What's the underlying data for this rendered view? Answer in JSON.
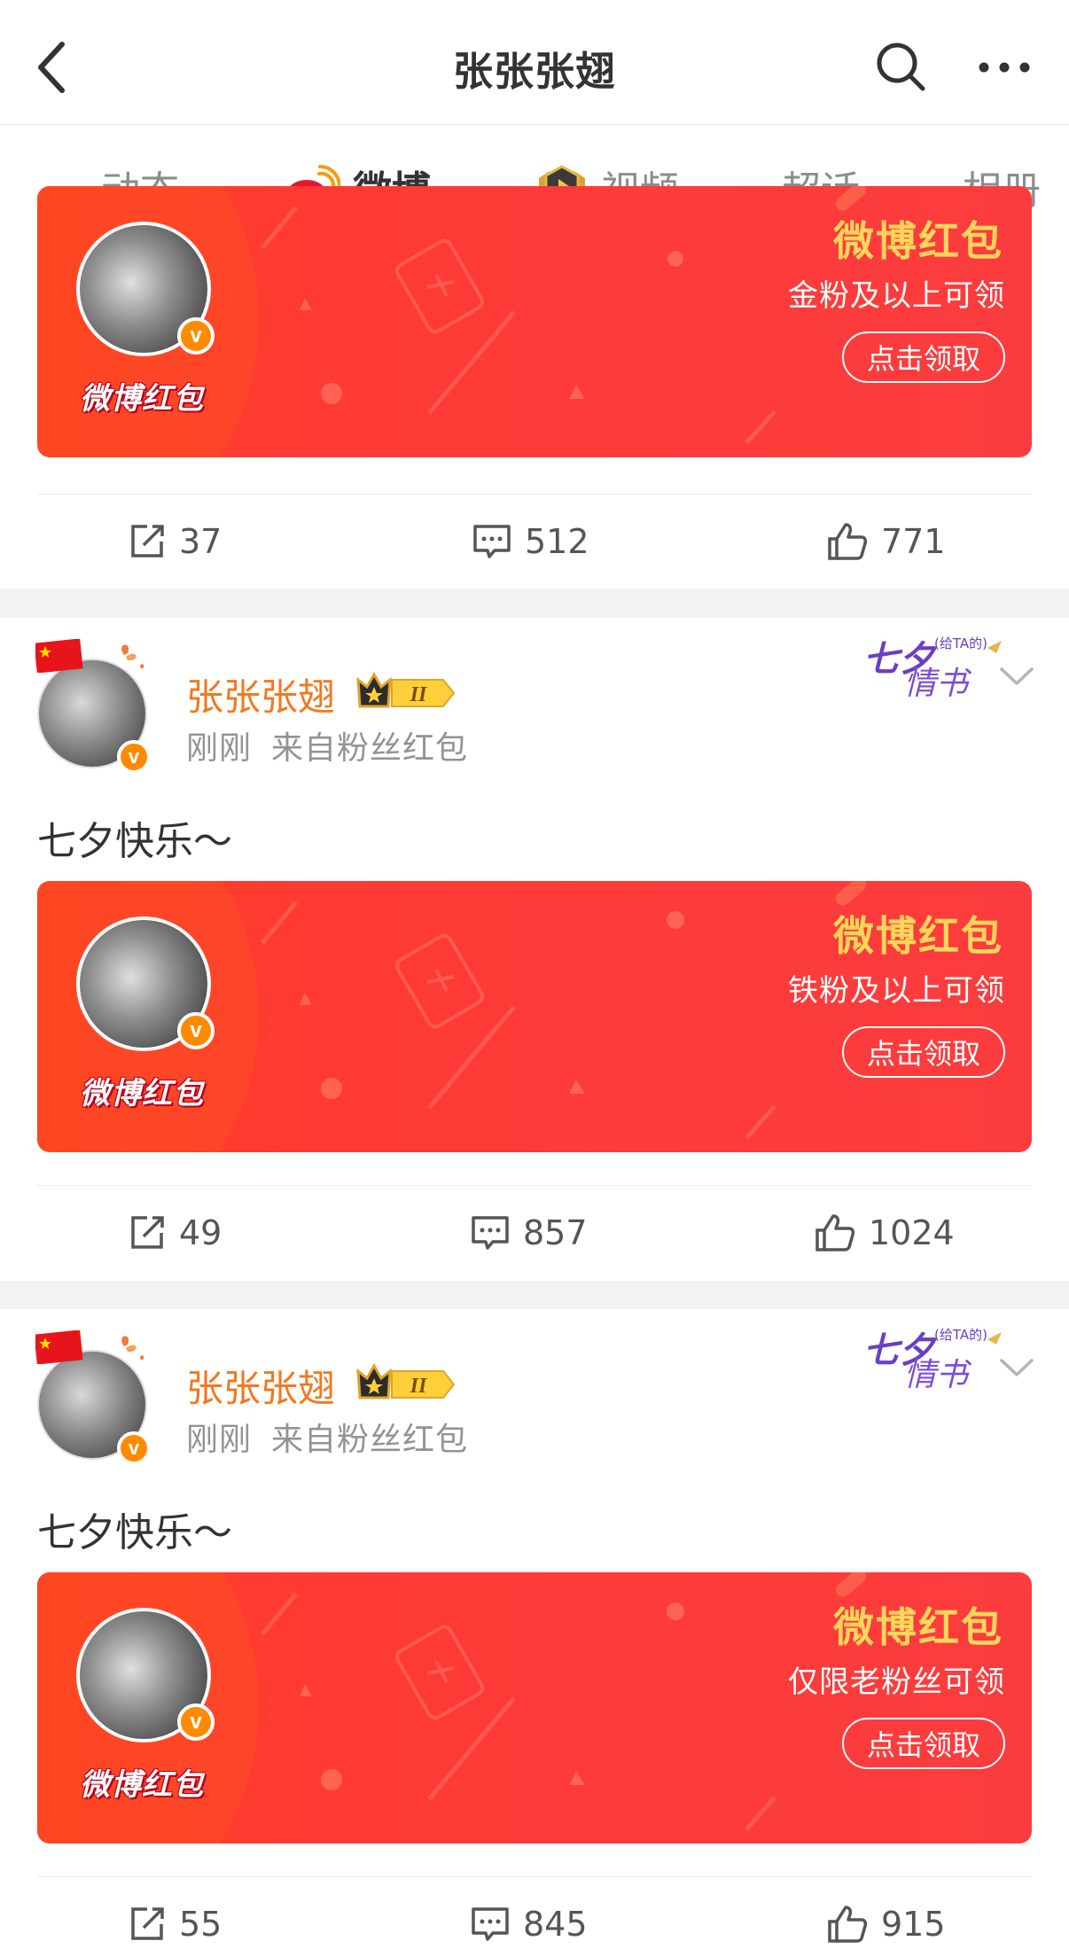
{
  "header": {
    "title": "张张张翅",
    "back_icon": "chevron-left-icon",
    "search_icon": "search-icon",
    "more_icon": "more-dots-icon"
  },
  "tabs": [
    {
      "label": "动态",
      "active": false
    },
    {
      "label": "微博",
      "active": true,
      "icon": "weibo-logo-icon"
    },
    {
      "label": "视频",
      "active": false,
      "icon": "video-play-badge-icon"
    },
    {
      "label": "超话",
      "active": false
    },
    {
      "label": "相册",
      "active": false
    }
  ],
  "colors": {
    "accent": "#ff8200",
    "username": "#f2781f",
    "banner_red": "#ff3d25",
    "banner_title": "#ffd65b"
  },
  "posts": [
    {
      "banner": {
        "brand": "微博红包",
        "title": "微博红包",
        "subtitle": "金粉及以上可领",
        "button": "点击领取"
      },
      "stats": {
        "repost": "37",
        "comment": "512",
        "like": "771"
      }
    },
    {
      "username": "张张张翅",
      "time": "刚刚",
      "source": "来自粉丝红包",
      "badge_text": "II",
      "decor": {
        "main": "七夕",
        "paren": "(给TA的)",
        "sub": "情书"
      },
      "text": "七夕快乐～",
      "banner": {
        "brand": "微博红包",
        "title": "微博红包",
        "subtitle": "铁粉及以上可领",
        "button": "点击领取"
      },
      "stats": {
        "repost": "49",
        "comment": "857",
        "like": "1024"
      }
    },
    {
      "username": "张张张翅",
      "time": "刚刚",
      "source": "来自粉丝红包",
      "badge_text": "II",
      "decor": {
        "main": "七夕",
        "paren": "(给TA的)",
        "sub": "情书"
      },
      "text": "七夕快乐～",
      "banner": {
        "brand": "微博红包",
        "title": "微博红包",
        "subtitle": "仅限老粉丝可领",
        "button": "点击领取"
      },
      "stats": {
        "repost": "55",
        "comment": "845",
        "like": "915"
      }
    }
  ]
}
